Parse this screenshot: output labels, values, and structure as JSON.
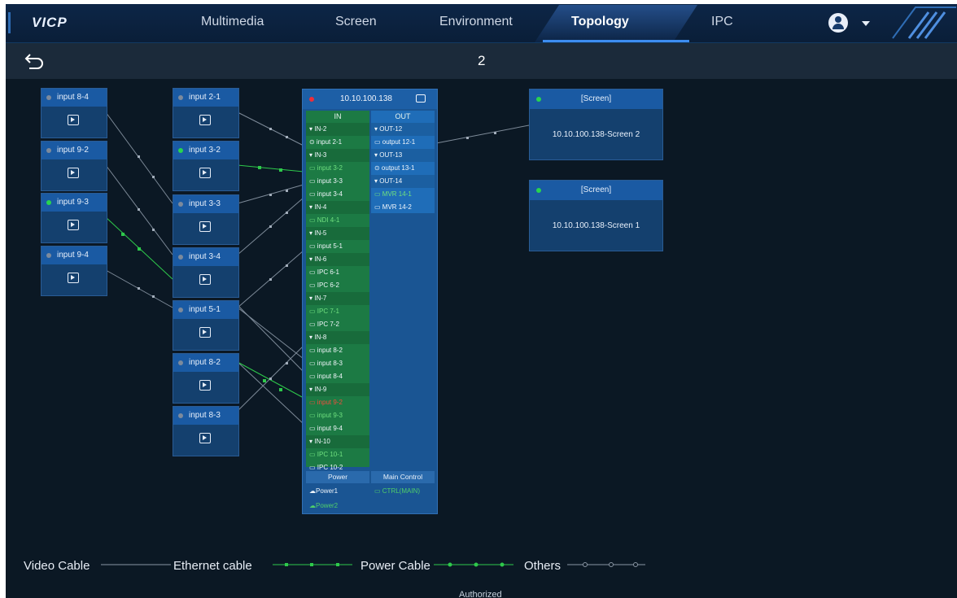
{
  "app": {
    "logo": "VICP"
  },
  "nav": {
    "tabs": [
      "Multimedia",
      "Screen",
      "Environment",
      "Topology",
      "IPC"
    ],
    "active": "Topology"
  },
  "subbar": {
    "page": "2"
  },
  "inputs_left": [
    {
      "label": "input 8-4",
      "online": false
    },
    {
      "label": "input 9-2",
      "online": false
    },
    {
      "label": "input 9-3",
      "online": true
    },
    {
      "label": "input 9-4",
      "online": false
    }
  ],
  "inputs_mid": [
    {
      "label": "input 2-1",
      "online": false
    },
    {
      "label": "input 3-2",
      "online": true
    },
    {
      "label": "input 3-3",
      "online": false
    },
    {
      "label": "input 3-4",
      "online": false
    },
    {
      "label": "input 5-1",
      "online": false
    },
    {
      "label": "input 8-2",
      "online": false
    },
    {
      "label": "input 8-3",
      "online": false
    }
  ],
  "device": {
    "ip": "10.10.100.138",
    "in_header": "IN",
    "out_header": "OUT",
    "in_rows": [
      {
        "text": "▾ IN-2",
        "type": "grp"
      },
      {
        "text": "⊙ input 2-1",
        "type": ""
      },
      {
        "text": "▾ IN-3",
        "type": "grp"
      },
      {
        "text": "▭ input 3-2",
        "type": "g"
      },
      {
        "text": "▭ input 3-3",
        "type": ""
      },
      {
        "text": "▭ input 3-4",
        "type": ""
      },
      {
        "text": "▾ IN-4",
        "type": "grp"
      },
      {
        "text": "▭ NDI 4-1",
        "type": "g"
      },
      {
        "text": "▾ IN-5",
        "type": "grp"
      },
      {
        "text": "▭ input 5-1",
        "type": ""
      },
      {
        "text": "▾ IN-6",
        "type": "grp"
      },
      {
        "text": "▭ IPC 6-1",
        "type": ""
      },
      {
        "text": "▭ IPC 6-2",
        "type": ""
      },
      {
        "text": "▾ IN-7",
        "type": "grp"
      },
      {
        "text": "▭ IPC 7-1",
        "type": "g"
      },
      {
        "text": "▭ IPC 7-2",
        "type": ""
      },
      {
        "text": "▾ IN-8",
        "type": "grp"
      },
      {
        "text": "▭ input 8-2",
        "type": ""
      },
      {
        "text": "▭ input 8-3",
        "type": ""
      },
      {
        "text": "▭ input 8-4",
        "type": ""
      },
      {
        "text": "▾ IN-9",
        "type": "grp"
      },
      {
        "text": "▭ input 9-2",
        "type": "r"
      },
      {
        "text": "▭ input 9-3",
        "type": "g"
      },
      {
        "text": "▭ input 9-4",
        "type": ""
      },
      {
        "text": "▾ IN-10",
        "type": "grp"
      },
      {
        "text": "▭ IPC 10-1",
        "type": "g"
      },
      {
        "text": "▭ IPC 10-2",
        "type": ""
      }
    ],
    "out_rows": [
      {
        "text": "▾ OUT-12",
        "type": "grp"
      },
      {
        "text": "▭ output 12-1",
        "type": ""
      },
      {
        "text": "▾ OUT-13",
        "type": "grp"
      },
      {
        "text": "⊙ output 13-1",
        "type": ""
      },
      {
        "text": "▾ OUT-14",
        "type": "grp"
      },
      {
        "text": "▭ MVR 14-1",
        "type": "g"
      },
      {
        "text": "▭ MVR 14-2",
        "type": ""
      }
    ],
    "power_header": "Power",
    "main_control_header": "Main Control",
    "power_items": [
      {
        "text": "Power1",
        "type": ""
      },
      {
        "text": "Power2",
        "type": "g"
      }
    ],
    "main_control_item": {
      "text": "CTRL(MAIN)",
      "type": "g"
    }
  },
  "screens": [
    {
      "title": "[Screen]",
      "name": "10.10.100.138-Screen 2"
    },
    {
      "title": "[Screen]",
      "name": "10.10.100.138-Screen 1"
    }
  ],
  "legend": {
    "video": "Video Cable",
    "ethernet": "Ethernet cable",
    "power": "Power Cable",
    "others": "Others"
  },
  "footer": {
    "text": "Authorized"
  },
  "colors": {
    "online": "#28d44f",
    "offline": "#7c8a9c",
    "alarm": "#ef2d39",
    "accent": "#3d8df0"
  }
}
